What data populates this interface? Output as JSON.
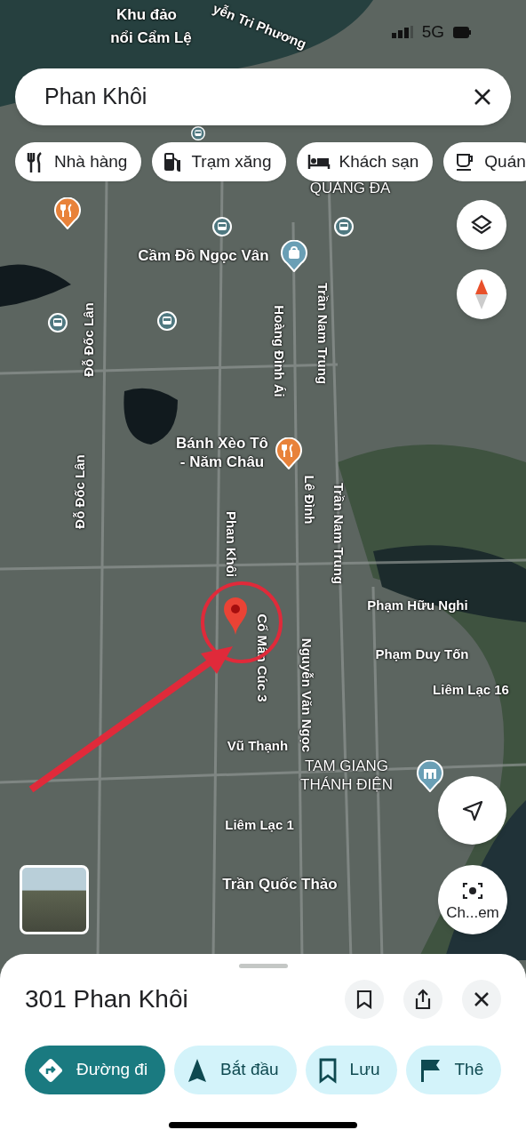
{
  "status_bar": {
    "network": "5G"
  },
  "search": {
    "value": "Phan Khôi"
  },
  "categories": [
    {
      "label": "Nhà hàng",
      "kind": "restaurant"
    },
    {
      "label": "Trạm xăng",
      "kind": "gas"
    },
    {
      "label": "Khách sạn",
      "kind": "hotel"
    },
    {
      "label": "Quán",
      "kind": "cafe"
    }
  ],
  "map": {
    "labels": [
      {
        "text": "Khu đảo",
        "kind": "place"
      },
      {
        "text": "nổi Cẩm Lệ",
        "kind": "place"
      },
      {
        "text": "yễn Tri Phương",
        "kind": "street"
      },
      {
        "text": "QUẢNG ĐA",
        "kind": "area"
      },
      {
        "text": "Cầm Đồ Ngọc Vân",
        "kind": "place"
      },
      {
        "text": "Hoàng Đình Ái",
        "kind": "street"
      },
      {
        "text": "Trần Nam Trung",
        "kind": "street"
      },
      {
        "text": "Đỗ Đốc Lân",
        "kind": "street"
      },
      {
        "text": "Đỗ Đốc Lân",
        "kind": "street"
      },
      {
        "text": "Bánh Xèo Tô\n- Năm Châu",
        "kind": "place"
      },
      {
        "text": "Lê Đình",
        "kind": "street"
      },
      {
        "text": "Phan Khôi",
        "kind": "street"
      },
      {
        "text": "Trần Nam Trung",
        "kind": "street"
      },
      {
        "text": "Phạm Hữu Nghi",
        "kind": "street"
      },
      {
        "text": "Phạm Duy Tốn",
        "kind": "street"
      },
      {
        "text": "Liêm Lạc 16",
        "kind": "street"
      },
      {
        "text": "Cổ Mân Cúc 3",
        "kind": "street"
      },
      {
        "text": "Nguyễn Văn Ngọc",
        "kind": "street"
      },
      {
        "text": "Vũ Thạnh",
        "kind": "street"
      },
      {
        "text": "TAM GIANG\nTHÁNH ĐIỆN",
        "kind": "area"
      },
      {
        "text": "Liêm Lạc 1",
        "kind": "street"
      },
      {
        "text": "Trần Quốc Thảo",
        "kind": "place"
      }
    ]
  },
  "camera_button": {
    "label": "Ch...em"
  },
  "place": {
    "title": "301 Phan Khôi"
  },
  "actions": [
    {
      "label": "Đường đi",
      "kind": "directions",
      "selected": true
    },
    {
      "label": "Bắt đầu",
      "kind": "start",
      "selected": false
    },
    {
      "label": "Lưu",
      "kind": "save",
      "selected": false
    },
    {
      "label": "Thê",
      "kind": "more",
      "selected": false
    }
  ]
}
